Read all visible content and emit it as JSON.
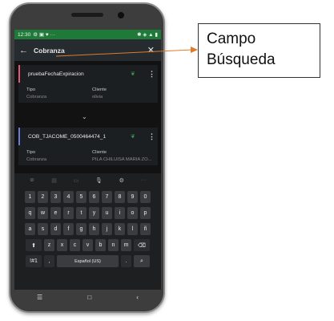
{
  "status_bar": {
    "time": "12:30",
    "left_icons": "⚙ ▣ ♥  ···",
    "right_icons": "✱ ◈ ▲ ▮"
  },
  "search": {
    "query": "Cobranza",
    "back_icon": "arrow-left-icon",
    "close_icon": "close-icon"
  },
  "cards": [
    {
      "title": "pruebaFechaExpiracion",
      "fields": [
        {
          "label": "Tipo",
          "value": "Cobranza"
        },
        {
          "label": "Cliente",
          "value": "olivia"
        }
      ]
    },
    {
      "title": "COB_TJACOME_0500464474_1",
      "fields": [
        {
          "label": "Tipo",
          "value": "Cobranza"
        },
        {
          "label": "Cliente",
          "value": "PILA CHILUISA MARIA ZO..."
        }
      ]
    }
  ],
  "keyboard": {
    "toolbar": [
      "☺",
      "▤",
      "▭",
      "🎙",
      "⚙",
      "···"
    ],
    "row_numbers": [
      "1",
      "2",
      "3",
      "4",
      "5",
      "6",
      "7",
      "8",
      "9",
      "0"
    ],
    "row1": [
      "q",
      "w",
      "e",
      "r",
      "t",
      "y",
      "u",
      "i",
      "o",
      "p"
    ],
    "row2": [
      "a",
      "s",
      "d",
      "f",
      "g",
      "h",
      "j",
      "k",
      "l",
      "ñ"
    ],
    "row3": [
      "z",
      "x",
      "c",
      "v",
      "b",
      "n",
      "m"
    ],
    "shift": "⬆",
    "backspace": "⌫",
    "symbols": "!#1",
    "comma": ",",
    "space_label": "Español (US)",
    "period": ".",
    "search_key": "⌕"
  },
  "nav": {
    "menu": "☰",
    "home": "□",
    "back": "‹"
  },
  "callout": {
    "line1": "Campo",
    "line2": "Búsqueda"
  },
  "colors": {
    "status_green": "#1f7a3a",
    "arrow": "#e07b2a",
    "card1_accent": "#e2577a",
    "card2_accent": "#6a7bd8"
  }
}
